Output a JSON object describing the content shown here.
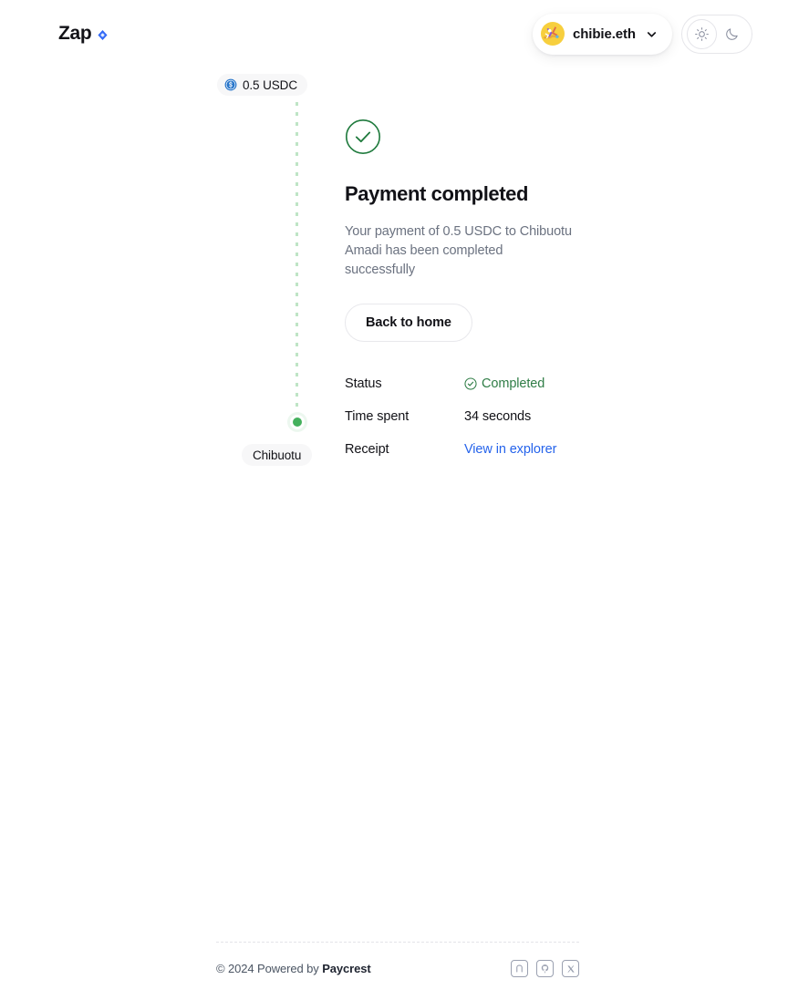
{
  "header": {
    "brand_name": "Zap",
    "brand_mark_icon": "blue-diamond-icon",
    "wallet": {
      "label": "chibie.eth",
      "avatar_icon": "wallet-avatar",
      "chevron_icon": "chevron-down-icon"
    },
    "theme": {
      "light_icon": "sun-icon",
      "dark_icon": "moon-icon",
      "active": "light"
    }
  },
  "timeline": {
    "token_amount": "0.5 USDC",
    "token_icon": "usdc-icon",
    "recipient_label": "Chibuotu",
    "node_color": "#43b05c",
    "line_color": "#bfe5c6"
  },
  "main": {
    "status_icon": "check-circle-icon",
    "title": "Payment completed",
    "subtitle": "Your payment of 0.5 USDC to Chibuotu Amadi has been completed successfully",
    "back_button": "Back to home",
    "details": [
      {
        "label": "Status",
        "value": "Completed",
        "type": "status",
        "icon": "check-circle-small-icon"
      },
      {
        "label": "Time spent",
        "value": "34 seconds",
        "type": "text",
        "icon": ""
      },
      {
        "label": "Receipt",
        "value": "View in explorer",
        "type": "link",
        "icon": ""
      }
    ]
  },
  "footer": {
    "copyright_prefix": "© 2024 Powered by ",
    "copyright_brand": "Paycrest",
    "social": [
      {
        "name": "paycrest-icon"
      },
      {
        "name": "github-icon"
      },
      {
        "name": "x-twitter-icon"
      }
    ]
  },
  "colors": {
    "accent_blue": "#2563eb",
    "success_green": "#2f7d46",
    "node_green": "#43b05c",
    "text_primary": "#121217",
    "text_muted": "#6b7280",
    "background": "#ffffff"
  }
}
